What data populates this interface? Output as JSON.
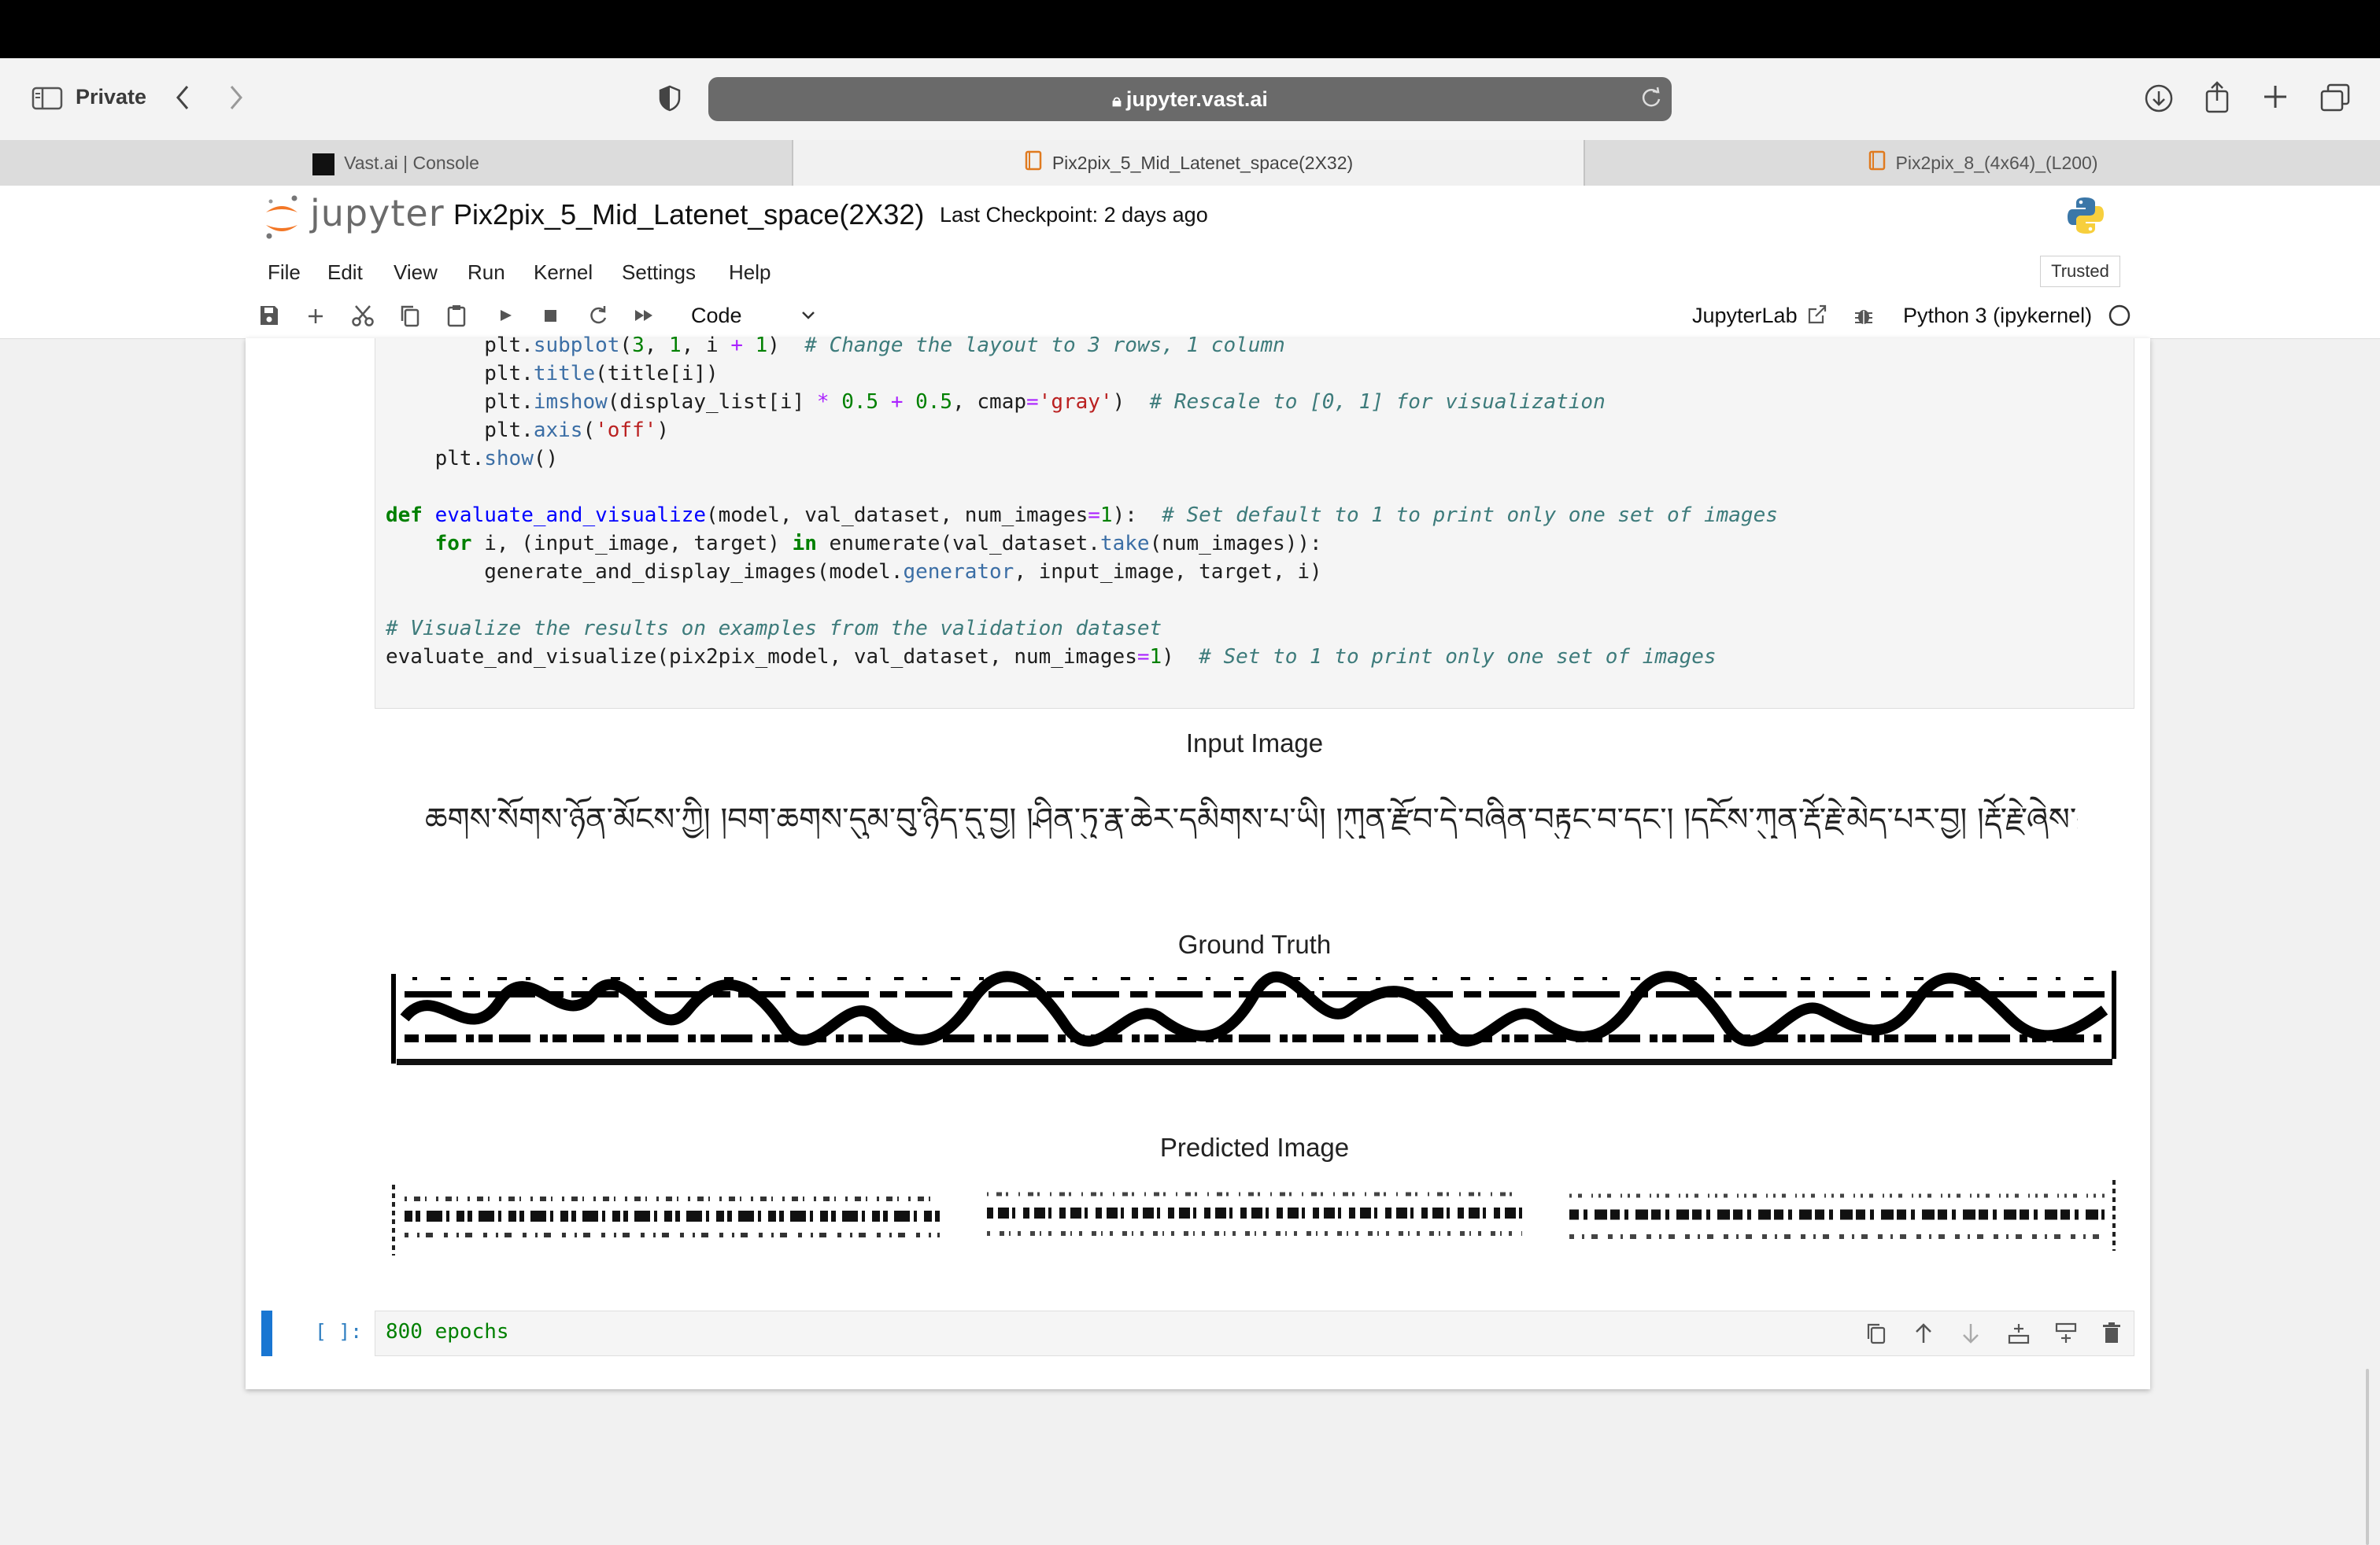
{
  "browser": {
    "mode_label": "Private",
    "address": "jupyter.vast.ai",
    "tabs": [
      {
        "label": "Vast.ai | Console",
        "active": false
      },
      {
        "label": "Pix2pix_5_Mid_Latenet_space(2X32)",
        "active": true
      },
      {
        "label": "Pix2pix_8_(4x64)_(L200)",
        "active": false
      }
    ]
  },
  "jupyter": {
    "logo_text": "jupyter",
    "notebook_title": "Pix2pix_5_Mid_Latenet_space(2X32)",
    "checkpoint": "Last Checkpoint: 2 days ago",
    "menu": [
      "File",
      "Edit",
      "View",
      "Run",
      "Kernel",
      "Settings",
      "Help"
    ],
    "trusted": "Trusted",
    "cell_type": "Code",
    "jupyterlab_label": "JupyterLab",
    "kernel": "Python 3 (ipykernel)"
  },
  "code_cell": {
    "lines": [
      "        plt.subplot(3, 1, i + 1)  # Change the layout to 3 rows, 1 column",
      "        plt.title(title[i])",
      "        plt.imshow(display_list[i] * 0.5 + 0.5, cmap='gray')  # Rescale to [0, 1] for visualization",
      "        plt.axis('off')",
      "    plt.show()",
      "",
      "def evaluate_and_visualize(model, val_dataset, num_images=1):  # Set default to 1 to print only one set of images",
      "    for i, (input_image, target) in enumerate(val_dataset.take(num_images)):",
      "        generate_and_display_images(model.generator, input_image, target, i)",
      "",
      "# Visualize the results on examples from the validation dataset",
      "evaluate_and_visualize(pix2pix_model, val_dataset, num_images=1)  # Set to 1 to print only one set of images"
    ]
  },
  "output": {
    "titles": [
      "Input Image",
      "Ground Truth",
      "Predicted Image"
    ],
    "input_text": "ཆགས་སོགས་ཉོན་མོངས་ཀྱི། །བག་ཆགས་དུམ་བུ་ཉིད་དུ་བྱ། །ཤིན་ཏུ་རྣ་ཆེར་དམིགས་པ་ཡི། །ཀུན་རྫོབ་དེ་བཞིན་བརྟུང་བ་དང་། །དངོས་ཀུན་རྡོ་རྗེ་མེད་པར་བྱ། །རྡོ་རྗེ་ཞེས་བྱ་དེ་"
  },
  "cell2": {
    "prompt": "[ ]:",
    "text": "800 epochs"
  }
}
